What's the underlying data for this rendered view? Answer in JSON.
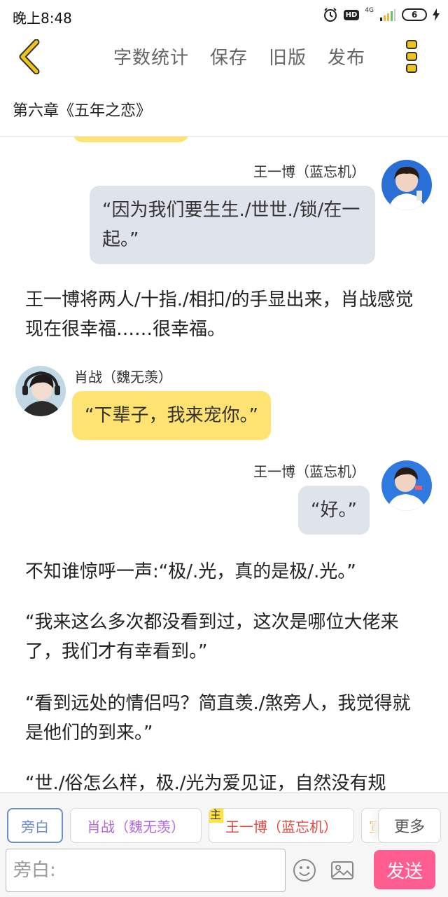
{
  "status_bar": {
    "time": "晚上8:48",
    "hd_label": "HD",
    "network_label": "4G",
    "battery_level": "6"
  },
  "toolbar": {
    "back_icon": "chevron-left-icon",
    "items": [
      "字数统计",
      "保存",
      "旧版",
      "发布"
    ],
    "more_icon": "vertical-dots-menu-icon",
    "accent_color": "#f0c419"
  },
  "chapter": {
    "title": "第六章《五年之恋》"
  },
  "messages": [
    {
      "type": "dialog",
      "side": "right",
      "speaker": "王一博（蓝忘机）",
      "text": "“因为我们要生生./世世./锁/在一起。”"
    },
    {
      "type": "narration",
      "text": "王一博将两人/十指./相扣/的手显出来，肖战感觉现在很幸福……很幸福。"
    },
    {
      "type": "dialog",
      "side": "left",
      "speaker": "肖战（魏无羡）",
      "text": "“下辈子，我来宠你。”"
    },
    {
      "type": "dialog",
      "side": "right",
      "speaker": "王一博（蓝忘机）",
      "text": "“好。”"
    },
    {
      "type": "narration",
      "text": "不知谁惊呼一声:“极/.光，真的是极/.光。”"
    },
    {
      "type": "narration",
      "text": "“我来这么多次都没看到过，这次是哪位大佬来了，我们才有幸看到。”"
    },
    {
      "type": "narration",
      "text": "“看到远处的情侣吗？简直羡./煞旁人，我觉得就是他们的到来。”"
    },
    {
      "type": "narration",
      "text": "“世./俗怎么样，极./光为爱见证，自然没有规"
    }
  ],
  "role_tabs": {
    "items": [
      "旁白",
      "肖战（魏无羡）",
      "王一博（蓝忘机）",
      "宣"
    ],
    "selected": "旁白",
    "main_badge": "主",
    "more_label": "更多"
  },
  "composer": {
    "placeholder": "旁白:",
    "send_label": "发送",
    "emoji_icon": "smiley-icon",
    "image_icon": "image-icon",
    "send_color": "#ff5d8f"
  }
}
